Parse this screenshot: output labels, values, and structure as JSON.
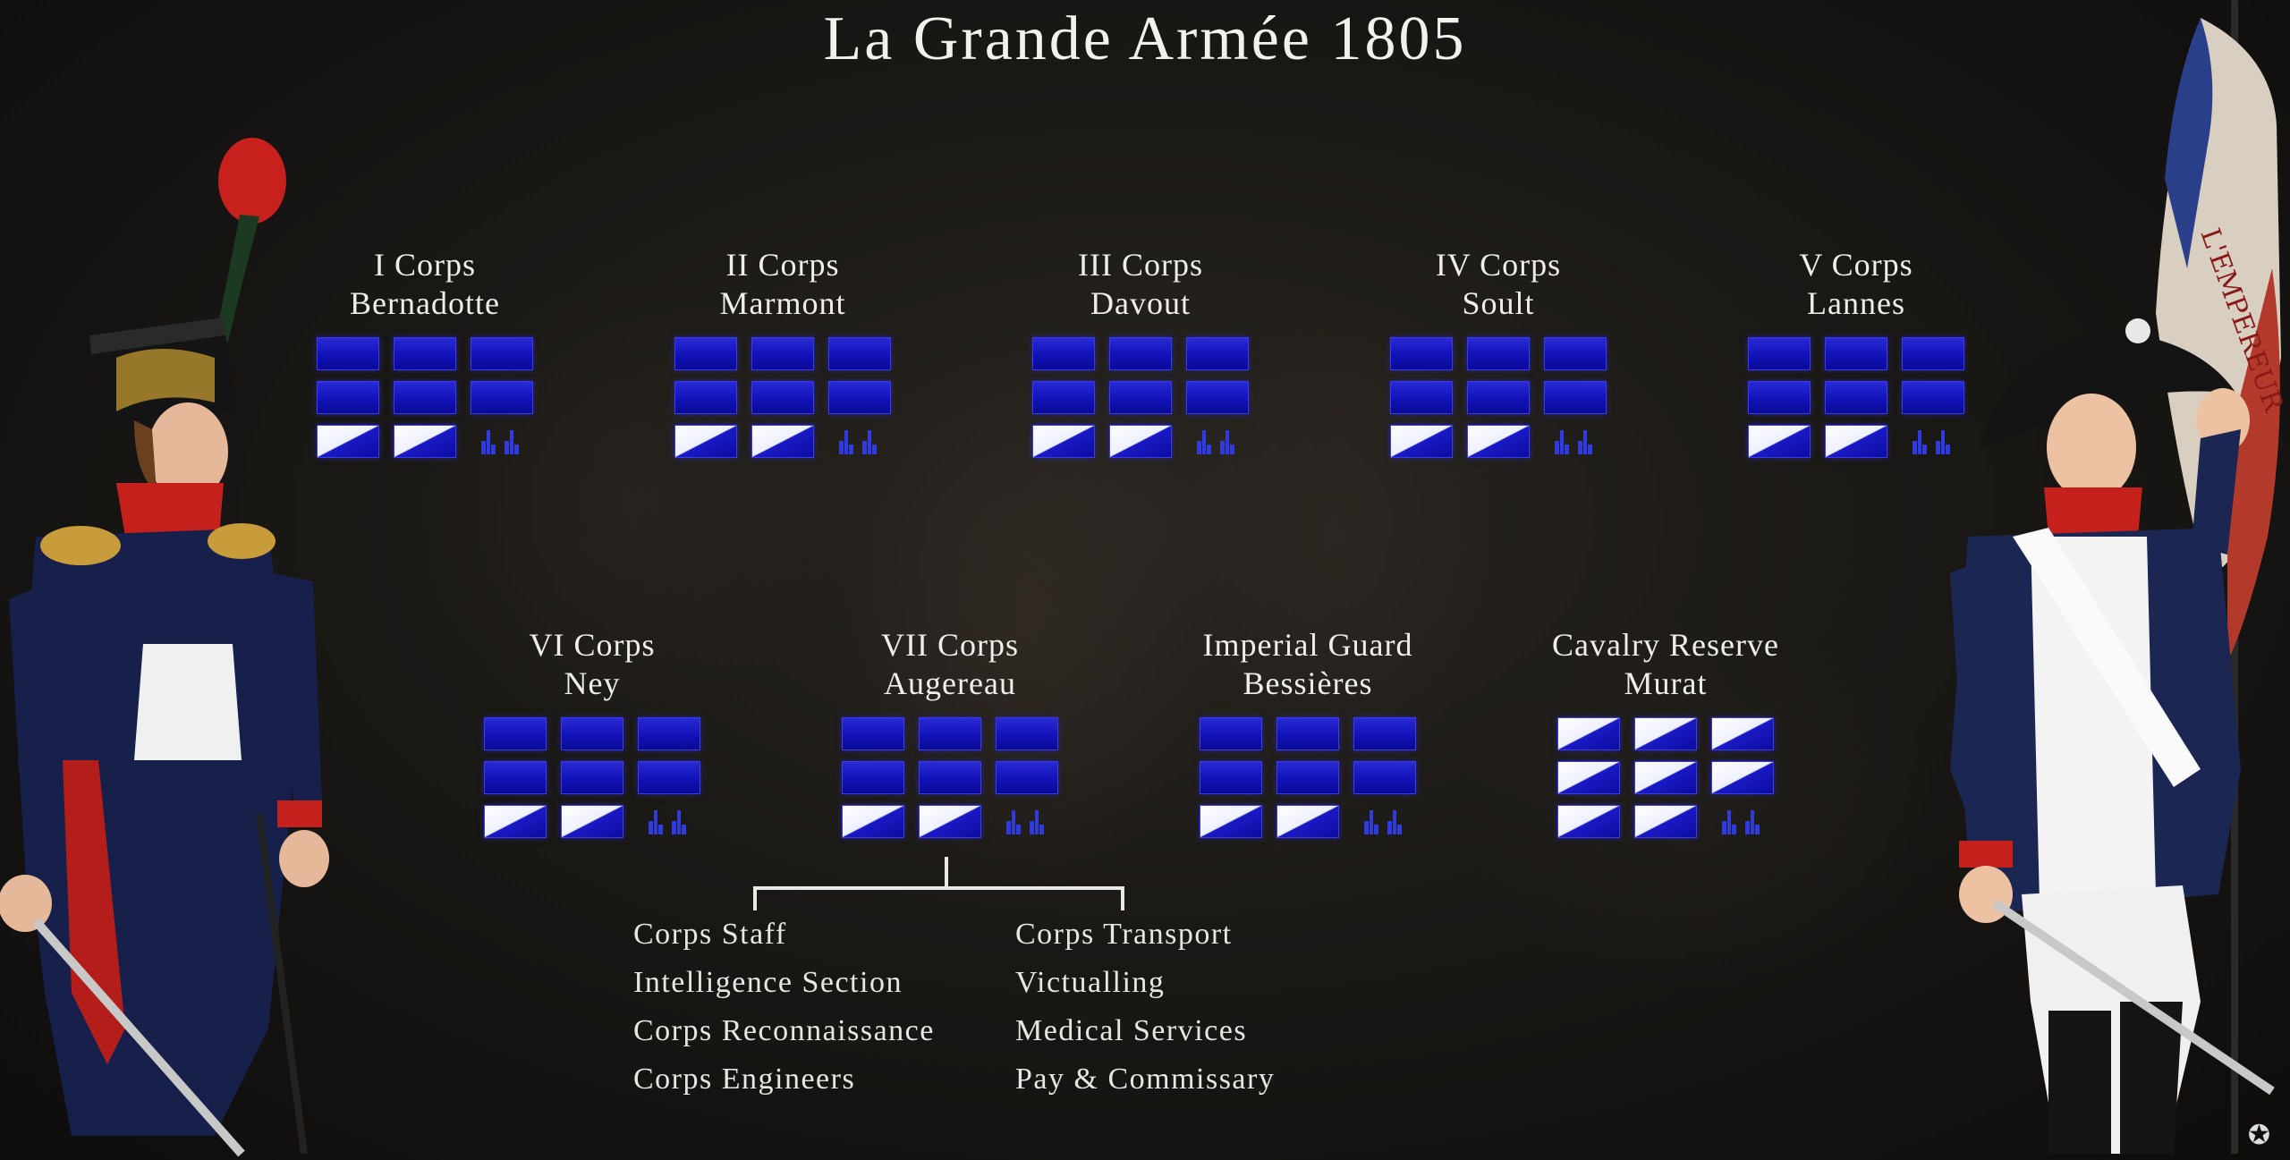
{
  "title": "La Grande Armée 1805",
  "units": [
    {
      "line1": "I Corps",
      "line2": "Bernadotte",
      "type": "corps"
    },
    {
      "line1": "II Corps",
      "line2": "Marmont",
      "type": "corps"
    },
    {
      "line1": "III Corps",
      "line2": "Davout",
      "type": "corps"
    },
    {
      "line1": "IV Corps",
      "line2": "Soult",
      "type": "corps"
    },
    {
      "line1": "V Corps",
      "line2": "Lannes",
      "type": "corps"
    },
    {
      "line1": "VI Corps",
      "line2": "Ney",
      "type": "corps"
    },
    {
      "line1": "VII Corps",
      "line2": "Augereau",
      "type": "corps"
    },
    {
      "line1": "Imperial Guard",
      "line2": "Bessières",
      "type": "corps"
    },
    {
      "line1": "Cavalry Reserve",
      "line2": "Murat",
      "type": "cavalry"
    }
  ],
  "support_left": [
    "Corps Staff",
    "Intelligence Section",
    "Corps Reconnaissance",
    "Corps Engineers"
  ],
  "support_right": [
    "Corps Transport",
    "Victualling",
    "Medical Services",
    "Pay & Commissary"
  ],
  "colors": {
    "infantry_blue": "#1414c0",
    "cavalry_white": "#ffffff",
    "artillery_blue": "#2a35d8"
  },
  "icons": {
    "corner": "star-logo-icon",
    "artillery": "artillery-icon"
  }
}
